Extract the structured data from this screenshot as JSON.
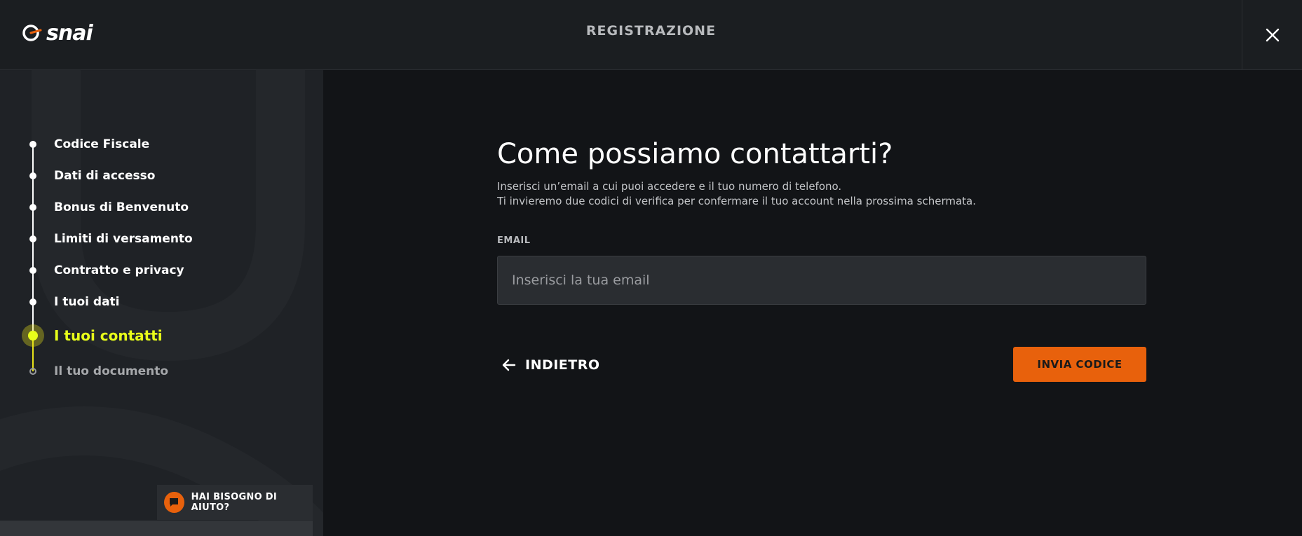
{
  "header": {
    "logo_text": "snai",
    "title": "REGISTRAZIONE",
    "close_icon": "close-icon"
  },
  "sidebar": {
    "steps": [
      {
        "label": "Codice Fiscale",
        "state": "done"
      },
      {
        "label": "Dati di accesso",
        "state": "done"
      },
      {
        "label": "Bonus di Benvenuto",
        "state": "done"
      },
      {
        "label": "Limiti di versamento",
        "state": "done"
      },
      {
        "label": "Contratto e privacy",
        "state": "done"
      },
      {
        "label": "I tuoi dati",
        "state": "done"
      },
      {
        "label": "I tuoi contatti",
        "state": "current"
      },
      {
        "label": "Il tuo documento",
        "state": "future"
      }
    ],
    "help_label": "HAI BISOGNO DI AIUTO?",
    "help_icon": "chat-icon"
  },
  "main": {
    "title": "Come possiamo contattarti?",
    "subtitle_line1": "Inserisci un’email a cui puoi accedere e il tuo numero di telefono.",
    "subtitle_line2": "Ti invieremo due codici di verifica per confermare il tuo account nella prossima schermata.",
    "email_label": "EMAIL",
    "email_placeholder": "Inserisci la tua email",
    "email_value": "",
    "back_label": "INDIETRO",
    "back_icon": "arrow-left-icon",
    "send_label": "INVIA CODICE"
  },
  "colors": {
    "accent_orange": "#e8610c",
    "current_step": "#e8ff1a",
    "background": "#121417",
    "sidebar": "#1f2226"
  }
}
